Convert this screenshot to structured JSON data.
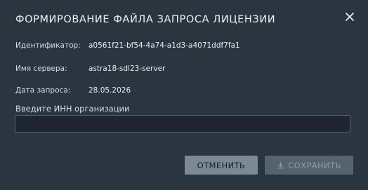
{
  "dialog": {
    "title": "ФОРМИРОВАНИЕ ФАЙЛА ЗАПРОСА ЛИЦЕНЗИИ",
    "close_icon": "close-icon"
  },
  "fields": {
    "identifier_label": "Идентификатор:",
    "identifier_value": "a0561f21-bf54-4a74-a1d3-a4071ddf7fa1",
    "server_label": "Имя сервера:",
    "server_value": "astra18-sdl23-server",
    "date_label": "Дата запроса:",
    "date_value": "28.05.2026"
  },
  "inn": {
    "label": "Введите ИНН организации",
    "value": "",
    "placeholder": ""
  },
  "buttons": {
    "cancel_label": "ОТМЕНИТЬ",
    "save_label": "СОХРАНИТЬ",
    "save_icon": "download-icon",
    "save_enabled": false
  },
  "colors": {
    "background": "#2b3540",
    "input_background": "#1d252e",
    "cancel_button": "#7c8895",
    "save_button_disabled": "#56636f"
  }
}
